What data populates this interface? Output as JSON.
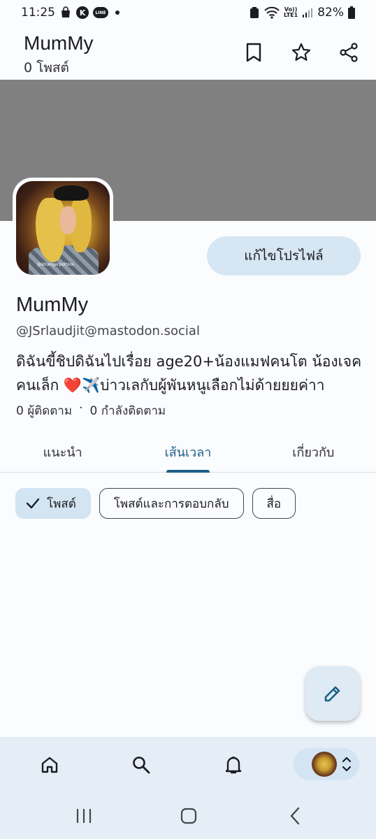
{
  "status_bar": {
    "time": "11:25",
    "k_badge": "K",
    "line_badge": "LINE",
    "volte_top": "Vo))",
    "volte_bottom": "LTE1",
    "battery": "82%"
  },
  "top_bar": {
    "title": "MumMy",
    "subtitle": "0 โพสต์"
  },
  "profile": {
    "avatar_caption": "@strangerpoltore",
    "edit_button": "แก้ไขโปรไฟล์",
    "display_name": "MumMy",
    "handle": "@JSrlaudjit@mastodon.social",
    "bio": "ดิฉันขี้ชิปดิฉันไปเรื่อย age20+น้องแมฟคนโต น้องเจคคนเล็ก ❤️✈️บ่าวเลกับผู้พันหนูเลือกไม่ด้ายยยค่าา",
    "followers": "0 ผู้ติดตาม",
    "separator": "·",
    "following": "0 กำลังติดตาม"
  },
  "tabs": [
    {
      "label": "แนะนำ"
    },
    {
      "label": "เส้นเวลา"
    },
    {
      "label": "เกี่ยวกับ"
    }
  ],
  "chips": {
    "posts": "โพสต์",
    "posts_replies": "โพสต์และการตอบกลับ",
    "media": "สื่อ"
  },
  "colors": {
    "accent": "#1c5f86",
    "banner": "#808080",
    "chip_selected": "#d3e4f3",
    "nav_bg": "#e5edf6"
  },
  "icons": [
    "bookmark-icon",
    "star-icon",
    "share-icon",
    "edit-icon",
    "home-icon",
    "search-icon",
    "bell-icon",
    "chevron-updown-icon",
    "recents-icon",
    "home-button-icon",
    "back-icon"
  ]
}
